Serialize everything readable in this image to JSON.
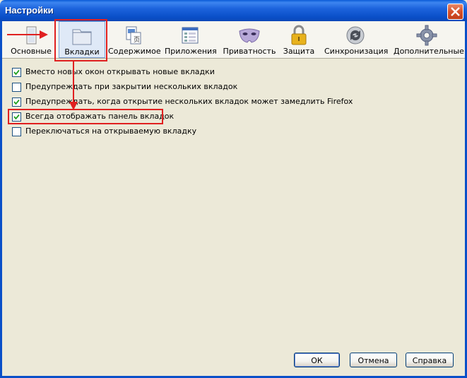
{
  "window": {
    "title": "Настройки"
  },
  "toolbar": [
    {
      "label": "Основные",
      "icon": "general-icon"
    },
    {
      "label": "Вкладки",
      "icon": "tabs-icon",
      "selected": true
    },
    {
      "label": "Содержимое",
      "icon": "content-icon"
    },
    {
      "label": "Приложения",
      "icon": "applications-icon"
    },
    {
      "label": "Приватность",
      "icon": "privacy-mask-icon"
    },
    {
      "label": "Защита",
      "icon": "lock-icon"
    },
    {
      "label": "Синхронизация",
      "icon": "sync-icon"
    },
    {
      "label": "Дополнительные",
      "icon": "gear-icon"
    }
  ],
  "options": [
    {
      "label": "Вместо новых окон открывать новые вкладки",
      "checked": true
    },
    {
      "label": "Предупреждать при закрытии нескольких вкладок",
      "checked": false
    },
    {
      "label": "Предупреждать, когда открытие нескольких вкладок может замедлить Firefox",
      "checked": true
    },
    {
      "label": "Всегда отображать панель вкладок",
      "checked": true
    },
    {
      "label": "Переключаться на открываемую вкладку",
      "checked": false
    }
  ],
  "buttons": {
    "ok": "ОК",
    "cancel": "Отмена",
    "help": "Справка"
  },
  "colors": {
    "annotation": "#e02020",
    "titlebar": "#0a4fc8"
  }
}
